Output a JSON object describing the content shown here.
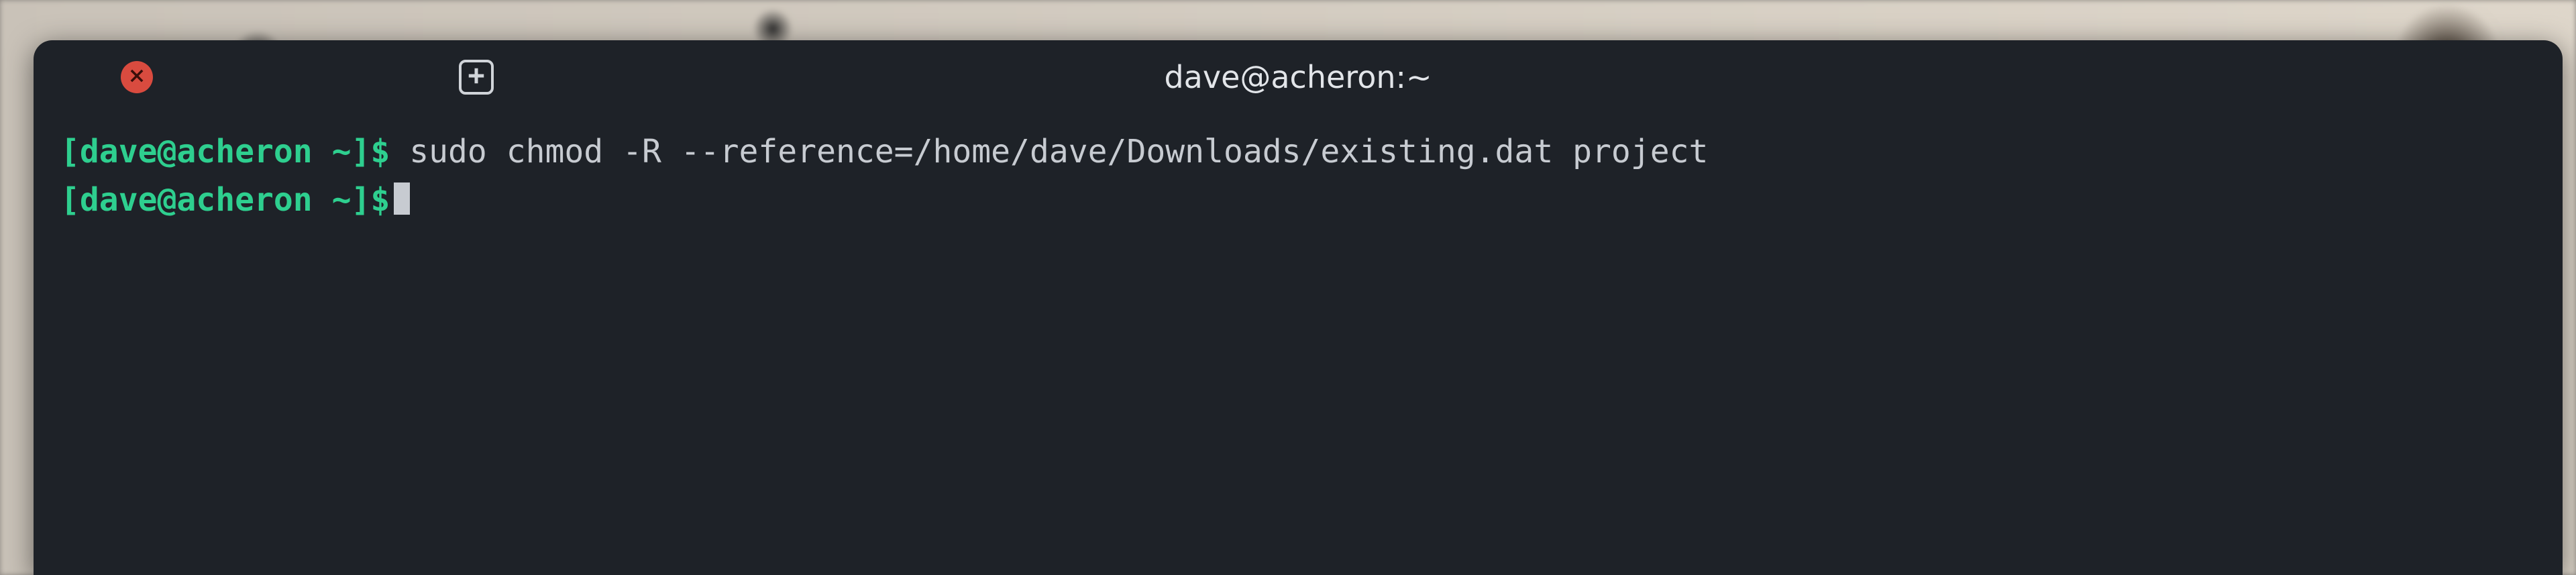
{
  "window": {
    "title": "dave@acheron:~"
  },
  "prompt": {
    "open_bracket": "[",
    "userhost": "dave@acheron",
    "path": " ~",
    "close_bracket": "]",
    "symbol": "$"
  },
  "lines": [
    {
      "command": "sudo chmod -R --reference=/home/dave/Downloads/existing.dat project"
    },
    {
      "command": ""
    }
  ],
  "icons": {
    "close": "close-icon",
    "minimize": "minimize-icon",
    "maximize": "maximize-icon",
    "newtab": "new-tab-icon"
  },
  "colors": {
    "terminal_bg": "#1e2228",
    "prompt_green": "#2ecf8f",
    "text": "#c7cbd1",
    "close_red": "#d94b3f"
  }
}
